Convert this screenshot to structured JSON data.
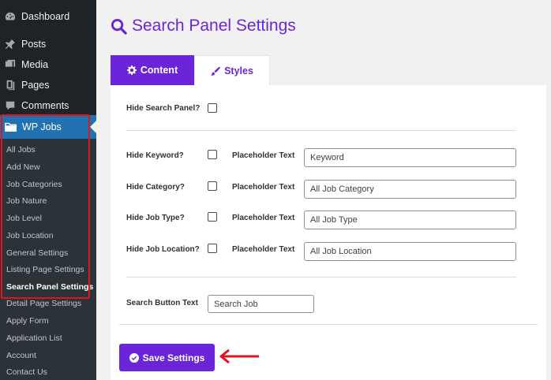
{
  "sidebar": {
    "items": [
      {
        "label": "Dashboard",
        "icon": "dashboard-icon"
      },
      {
        "label": "Posts",
        "icon": "pin-icon"
      },
      {
        "label": "Media",
        "icon": "media-icon"
      },
      {
        "label": "Pages",
        "icon": "pages-icon"
      },
      {
        "label": "Comments",
        "icon": "comment-icon"
      }
    ],
    "active_menu": {
      "label": "WP Jobs",
      "icon": "folder-icon"
    },
    "submenu": [
      "All Jobs",
      "Add New",
      "Job Categories",
      "Job Nature",
      "Job Level",
      "Job Location",
      "General Settings",
      "Listing Page Settings",
      "Search Panel Settings",
      "Detail Page Settings",
      "Apply Form",
      "Application List",
      "Account",
      "Contact Us"
    ],
    "current_submenu": "Search Panel Settings"
  },
  "page": {
    "title": "Search Panel Settings",
    "title_icon": "search-icon"
  },
  "tabs": {
    "content": "Content",
    "styles": "Styles"
  },
  "form": {
    "hide_search_panel": {
      "label": "Hide Search Panel?",
      "checked": false
    },
    "rows": [
      {
        "label": "Hide Keyword?",
        "checked": false,
        "placeholder_label": "Placeholder Text",
        "value": "Keyword"
      },
      {
        "label": "Hide Category?",
        "checked": false,
        "placeholder_label": "Placeholder Text",
        "value": "All Job Category"
      },
      {
        "label": "Hide Job Type?",
        "checked": false,
        "placeholder_label": "Placeholder Text",
        "value": "All Job Type"
      },
      {
        "label": "Hide Job Location?",
        "checked": false,
        "placeholder_label": "Placeholder Text",
        "value": "All Job Location"
      }
    ],
    "search_button": {
      "label": "Search Button Text",
      "value": "Search Job"
    },
    "save_label": "Save Settings"
  },
  "colors": {
    "accent": "#6b25d9",
    "sidebar_bg": "#1d2327",
    "active_menu": "#2271b1",
    "highlight": "#e0141e"
  }
}
